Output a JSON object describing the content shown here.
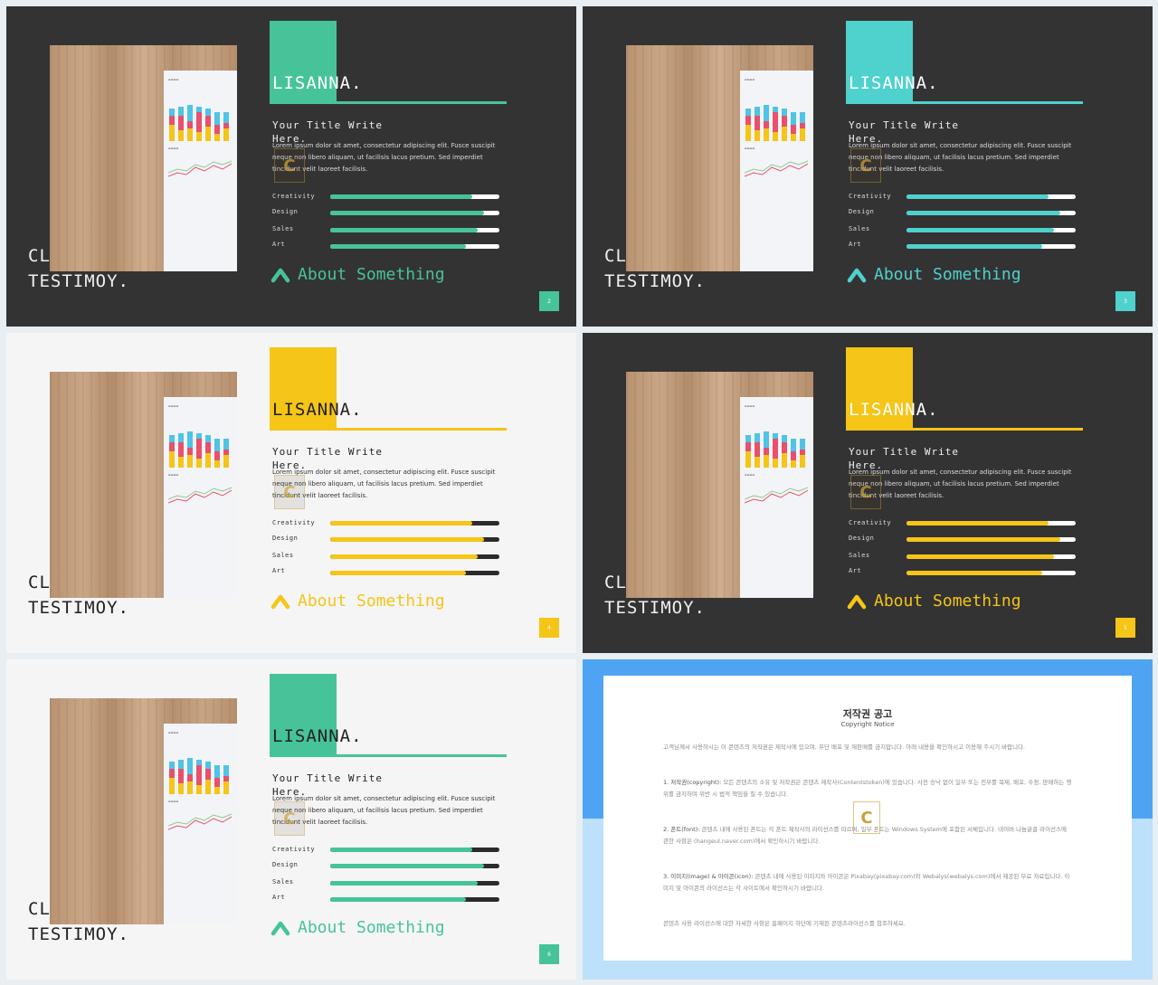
{
  "colors": {
    "green": "#47c39a",
    "teal": "#4fd1cd",
    "yellow": "#f5c518",
    "dark_bg": "#333333",
    "light_bg": "#f5f5f5",
    "blue": "#4ea4f2",
    "light_blue": "#bde0fb"
  },
  "slides": [
    {
      "theme": "dark",
      "accent": "#47c39a",
      "brand": "LISANNA.",
      "title": "Your Title Write Here.",
      "body": "Lorem ipsum dolor sit amet, consectetur adipiscing elit. Fusce suscipit neque non libero aliquam, ut facilisis lacus pretium. Sed imperdiet tincidunt velit laoreet facilisis.",
      "left_line1": "CL",
      "left_line2": "TESTIMOY.",
      "about": "About Something",
      "page": "2",
      "skills": [
        {
          "label": "Creativity",
          "value": 0.84
        },
        {
          "label": "Design",
          "value": 0.91
        },
        {
          "label": "Sales",
          "value": 0.87
        },
        {
          "label": "Art",
          "value": 0.8
        }
      ]
    },
    {
      "theme": "dark",
      "accent": "#4fd1cd",
      "brand": "LISANNA.",
      "title": "Your Title Write Here.",
      "body": "Lorem ipsum dolor sit amet, consectetur adipiscing elit. Fusce suscipit neque non libero aliquam, ut facilisis lacus pretium. Sed imperdiet tincidunt velit laoreet facilisis.",
      "left_line1": "CL",
      "left_line2": "TESTIMOY.",
      "about": "About Something",
      "page": "3",
      "skills": [
        {
          "label": "Creativity",
          "value": 0.84
        },
        {
          "label": "Design",
          "value": 0.91
        },
        {
          "label": "Sales",
          "value": 0.87
        },
        {
          "label": "Art",
          "value": 0.8
        }
      ]
    },
    {
      "theme": "light",
      "accent": "#f5c518",
      "brand": "LISANNA.",
      "title": "Your Title Write Here.",
      "body": "Lorem ipsum dolor sit amet, consectetur adipiscing elit. Fusce suscipit neque non libero aliquam, ut facilisis lacus pretium. Sed imperdiet tincidunt velit laoreet facilisis.",
      "left_line1": "CL",
      "left_line2": "TESTIMOY.",
      "about": "About Something",
      "page": "4",
      "skills": [
        {
          "label": "Creativity",
          "value": 0.84
        },
        {
          "label": "Design",
          "value": 0.91
        },
        {
          "label": "Sales",
          "value": 0.87
        },
        {
          "label": "Art",
          "value": 0.8
        }
      ]
    },
    {
      "theme": "dark",
      "accent": "#f5c518",
      "brand": "LISANNA.",
      "title": "Your Title Write Here.",
      "body": "Lorem ipsum dolor sit amet, consectetur adipiscing elit. Fusce suscipit neque non libero aliquam, ut facilisis lacus pretium. Sed imperdiet tincidunt velit laoreet facilisis.",
      "left_line1": "CL",
      "left_line2": "TESTIMOY.",
      "about": "About Something",
      "page": "5",
      "skills": [
        {
          "label": "Creativity",
          "value": 0.84
        },
        {
          "label": "Design",
          "value": 0.91
        },
        {
          "label": "Sales",
          "value": 0.87
        },
        {
          "label": "Art",
          "value": 0.8
        }
      ]
    },
    {
      "theme": "light",
      "accent": "#47c39a",
      "brand": "LISANNA.",
      "title": "Your Title Write Here.",
      "body": "Lorem ipsum dolor sit amet, consectetur adipiscing elit. Fusce suscipit neque non libero aliquam, ut facilisis lacus pretium. Sed imperdiet tincidunt velit laoreet facilisis.",
      "left_line1": "CL",
      "left_line2": "TESTIMOY.",
      "about": "About Something",
      "page": "6",
      "skills": [
        {
          "label": "Creativity",
          "value": 0.84
        },
        {
          "label": "Design",
          "value": 0.91
        },
        {
          "label": "Sales",
          "value": 0.87
        },
        {
          "label": "Art",
          "value": 0.8
        }
      ]
    }
  ],
  "copyright": {
    "title": "저작권 공고",
    "subtitle": "Copyright Notice",
    "intro": "고객님께서 사용하시는 이 콘텐츠의 저작권은 제작사에 있으며, 무단 배포 및 재판매를 금지합니다. 아래 내용을 확인하시고 이용해 주시기 바랍니다.",
    "p1_head": "1. 저작권(copyright):",
    "p1": "모든 콘텐츠의 소유 및 저작권은 콘텐츠 제작사(Contentstoken)에 있습니다. 사전 승낙 없이 일부 또는 전부를 복제, 배포, 수정, 판매하는 행위를 금지하며 위반 시 법적 책임을 질 수 있습니다.",
    "p2_head": "2. 폰트(font):",
    "p2": "콘텐츠 내에 사용된 폰트는 각 폰트 제작사의 라이선스를 따르며, 일부 폰트는 Windows System에 포함된 서체입니다. 네이버 나눔글꼴 라이선스에 관한 사항은 (hangeul.naver.com)에서 확인하시기 바랍니다.",
    "p3_head": "3. 이미지(image) & 아이콘(icon):",
    "p3": "콘텐츠 내에 사용된 이미지와 아이콘은 Pixabay(pixabay.com)와 Webalys(webalys.com)에서 제공된 무료 자료입니다. 이미지 및 아이콘의 라이선스는 각 사이트에서 확인하시기 바랍니다.",
    "footer": "콘텐츠 사용 라이선스에 대한 자세한 사항은 홈페이지 하단에 기재된 콘텐츠라이선스를 참조하세요."
  }
}
